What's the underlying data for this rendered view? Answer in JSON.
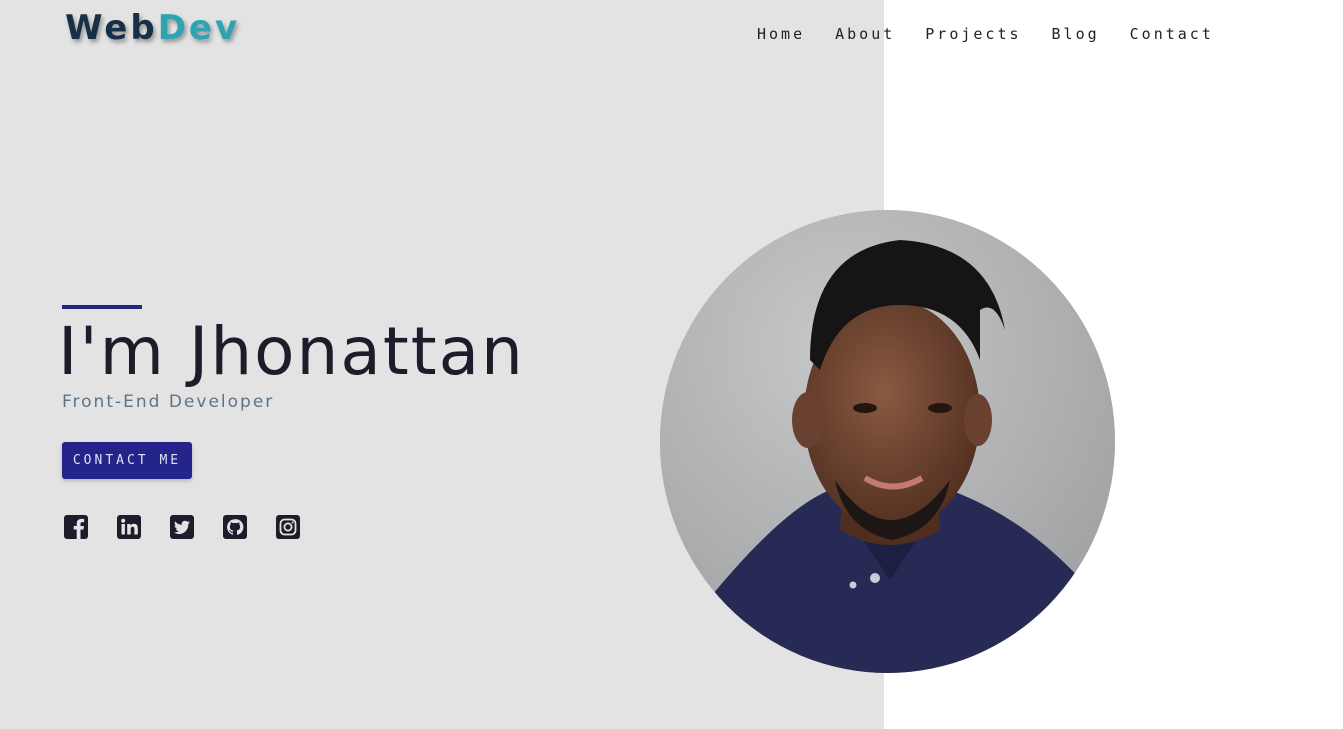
{
  "brand": {
    "part1": "Web",
    "part2": "Dev"
  },
  "nav": {
    "items": [
      {
        "label": "Home"
      },
      {
        "label": "About"
      },
      {
        "label": "Projects"
      },
      {
        "label": "Blog"
      },
      {
        "label": "Contact"
      }
    ]
  },
  "hero": {
    "title": "I'm Jhonattan",
    "subtitle": "Front-End Developer",
    "cta_label": "CONTACT ME"
  },
  "socials": [
    {
      "icon": "facebook-icon"
    },
    {
      "icon": "linkedin-icon"
    },
    {
      "icon": "twitter-icon"
    },
    {
      "icon": "github-icon"
    },
    {
      "icon": "instagram-icon"
    }
  ],
  "colors": {
    "left_panel": "#e3e3e3",
    "accent": "#25248a",
    "brand_dark": "#173048",
    "brand_teal": "#2ea3b2",
    "subtitle": "#5e7486"
  }
}
